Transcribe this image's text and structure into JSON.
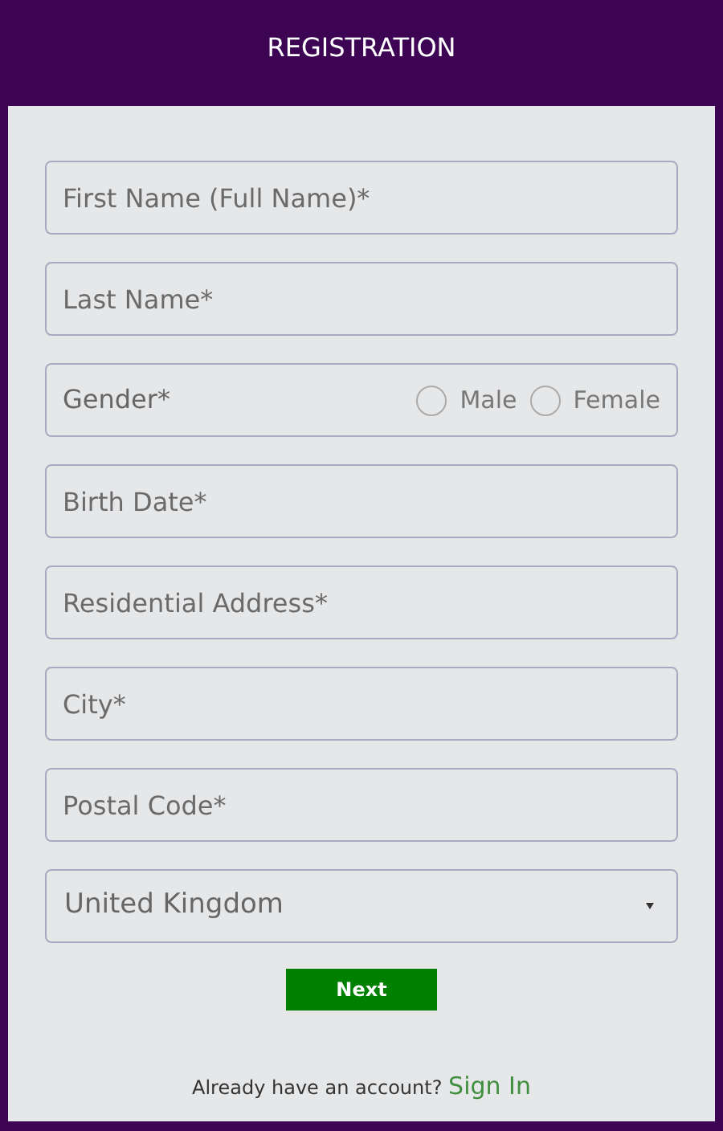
{
  "header": {
    "title": "REGISTRATION"
  },
  "fields": [
    {
      "kind": "text",
      "placeholder": "First Name (Full Name)*"
    },
    {
      "kind": "text",
      "placeholder": "Last Name*"
    },
    {
      "kind": "radio",
      "label": "Gender*",
      "options": [
        {
          "label": "Male",
          "selected": false
        },
        {
          "label": "Female",
          "selected": false
        }
      ]
    },
    {
      "kind": "text",
      "placeholder": "Birth Date*"
    },
    {
      "kind": "text",
      "placeholder": "Residential Address*"
    },
    {
      "kind": "text",
      "placeholder": "City*"
    },
    {
      "kind": "text",
      "placeholder": "Postal Code*"
    },
    {
      "kind": "select",
      "value": "United Kingdom"
    }
  ],
  "next_button": "Next",
  "footer": {
    "text": "Already have an account?",
    "link": "Sign In"
  }
}
